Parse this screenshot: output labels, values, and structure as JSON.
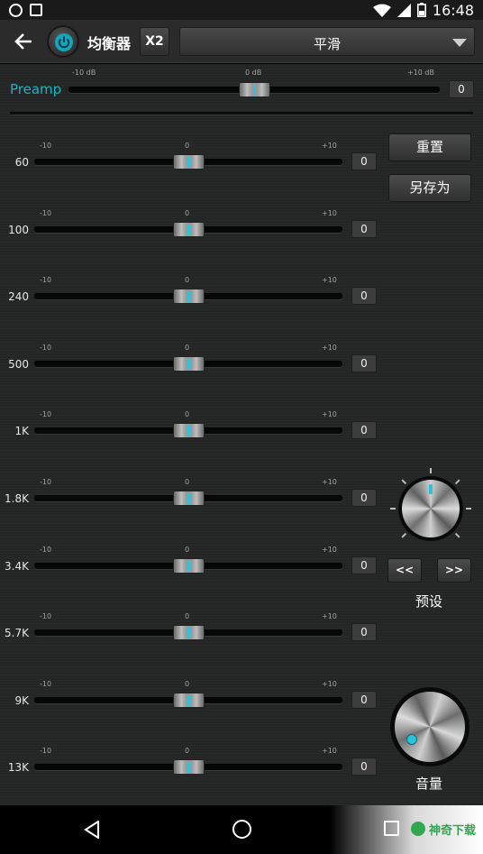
{
  "status_bar": {
    "time": "16:48",
    "icons": [
      "sync-icon",
      "app-a-icon",
      "wifi-icon",
      "signal-icon",
      "battery-icon"
    ]
  },
  "toolbar": {
    "back_icon": "arrow-left-icon",
    "power_icon": "power-icon",
    "title": "均衡器",
    "x2_label": "X2",
    "preset_value": "平滑"
  },
  "preamp": {
    "label": "Preamp",
    "scale_min": "-10 dB",
    "scale_mid": "0 dB",
    "scale_max": "+10 dB",
    "value": "0",
    "level": 0
  },
  "band_scale": {
    "min": "-10",
    "mid": "0",
    "max": "+10"
  },
  "bands": [
    {
      "label": "60",
      "value": "0",
      "level": 0
    },
    {
      "label": "100",
      "value": "0",
      "level": 0
    },
    {
      "label": "240",
      "value": "0",
      "level": 0
    },
    {
      "label": "500",
      "value": "0",
      "level": 0
    },
    {
      "label": "1K",
      "value": "0",
      "level": 0
    },
    {
      "label": "1.8K",
      "value": "0",
      "level": 0
    },
    {
      "label": "3.4K",
      "value": "0",
      "level": 0
    },
    {
      "label": "5.7K",
      "value": "0",
      "level": 0
    },
    {
      "label": "9K",
      "value": "0",
      "level": 0
    },
    {
      "label": "13K",
      "value": "0",
      "level": 0
    }
  ],
  "side": {
    "reset_label": "重置",
    "save_as_label": "另存为",
    "prev_label": "<<",
    "next_label": ">>",
    "preset_knob_label": "预设",
    "volume_knob_label": "音量"
  },
  "nav": {
    "back_icon": "nav-back-icon",
    "home_icon": "nav-home-icon",
    "recent_icon": "nav-recent-icon"
  },
  "watermark": {
    "text": "神奇下载"
  },
  "colors": {
    "accent": "#19b4c8",
    "background": "#242626",
    "toolbar": "#2b2b2b"
  }
}
